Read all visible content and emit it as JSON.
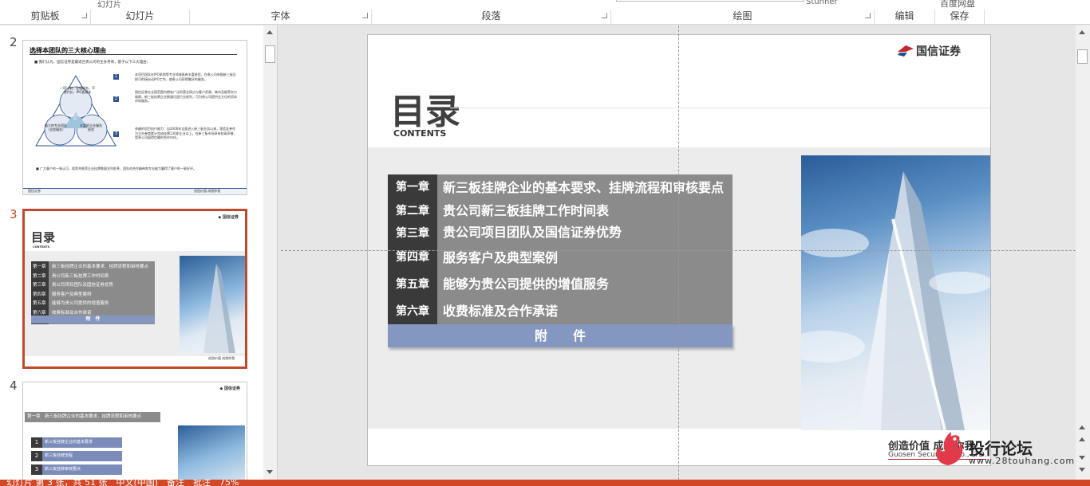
{
  "ribbon": {
    "trim_labels": [
      "幻灯片",
      "Stunner"
    ],
    "groups": [
      {
        "label": "剪贴板",
        "id": "clipboard"
      },
      {
        "label": "幻灯片",
        "id": "slides"
      },
      {
        "label": "字体",
        "id": "font"
      },
      {
        "label": "段落",
        "id": "paragraph"
      },
      {
        "label": "绘图",
        "id": "drawing"
      },
      {
        "label": "编辑",
        "id": "editing"
      },
      {
        "label": "保存",
        "id": "save"
      }
    ],
    "baidu_label": "百度网盘"
  },
  "thumbnails": [
    {
      "number": "2",
      "title": "选择本团队的三大核心理由",
      "intro": "■ 我们认为，国信证券是最适合贵公司的主办券商，基于以下三大理由：",
      "triangle_center": "选择本团队的三大理由",
      "triangle_top": "一项计划，全程服务，不惜代价，IPO直通车",
      "triangle_left": "强大的专业团队（全程服务）",
      "triangle_right": "丰富的企业服务经验",
      "reasons": [
        {
          "num": "1",
          "text": "本项目团队在IPO承销等专业领域具有丰富经验，在贵公司申报新三板后即可衔接启动IPO工作，使贵公司获得最好的服务。"
        },
        {
          "num": "2",
          "text": "国信证券在全国范围内拥有广泛的营业网点与客户资源，做市及推荐实力雄厚，新三板挂牌企业数量位居行业前列，可为贵公司提供全方位的资本市场服务。"
        },
        {
          "num": "3",
          "text": "卓越的项目执行能力：自2006年全面进入新三板业务以来，国信证券作为主办券商累计完成挂牌130家企业以上，在新三板市场享有较高声誉，是贵公司值得信赖的合作伙伴。"
        }
      ],
      "bottom_note": "■ 广大客户的一致认可，保荐并推荐企业挂牌数量名列前茅，团队的合作精神和专业能力赢得了客户的一致好评。",
      "footer_logo": "国信证券",
      "footer_right": "创造价值 成就你我"
    },
    {
      "number": "3",
      "title": "目录",
      "subtitle": "CONTENTS",
      "chapters": [
        "第一章",
        "第二章",
        "第三章",
        "第四章",
        "第五章",
        "第六章"
      ],
      "items": [
        "新三板挂牌企业的基本要求、挂牌流程和审核要点",
        "贵公司新三板挂牌工作时间表",
        "贵公司项目团队及国信证券优势",
        "服务客户及典型案例",
        "能够为贵公司提供的增值服务",
        "收费标准及合作承诺"
      ],
      "appendix": "附　件",
      "footer": "创造价值 成就你我"
    },
    {
      "number": "4",
      "header": "第一章　新三板挂牌企业的基本要求、挂牌流程和审核要点",
      "items": [
        {
          "num": "1",
          "text": "新三板挂牌企业的基本要求"
        },
        {
          "num": "2",
          "text": "新三板挂牌流程"
        },
        {
          "num": "3",
          "text": "新三板挂牌审核要点"
        }
      ]
    }
  ],
  "slide": {
    "logo_text": "国信证券",
    "title": "目录",
    "subtitle": "CONTENTS",
    "chapters": [
      {
        "tag": "第一章",
        "text": "新三板挂牌企业的基本要求、挂牌流程和审核要点"
      },
      {
        "tag": "第二章",
        "text": "贵公司新三板挂牌工作时间表"
      },
      {
        "tag": "第三章",
        "text": "贵公司项目团队及国信证券优势"
      },
      {
        "tag": "第四章",
        "text": "服务客户及典型案例"
      },
      {
        "tag": "第五章",
        "text": "能够为贵公司提供的增值服务"
      },
      {
        "tag": "第六章",
        "text": "收费标准及合作承诺"
      }
    ],
    "appendix": "附　　件",
    "footer_slogan": "创造价值 成就你我",
    "footer_company": "Guosen Securities Co., LTD."
  },
  "watermark": {
    "logo_num": "8",
    "title": "投行论坛",
    "url": "www.28touhang.com"
  },
  "statusbar": {
    "text": "幻灯片 第 3 张，共 51 张　中文(中国)　备注　批注　75%"
  },
  "colors": {
    "accent": "#c1492b",
    "status_bar": "#d24726",
    "chapter_tag": "#3a3a3a",
    "chapter_row": "#8b8b8b",
    "appendix": "#8497c0"
  }
}
